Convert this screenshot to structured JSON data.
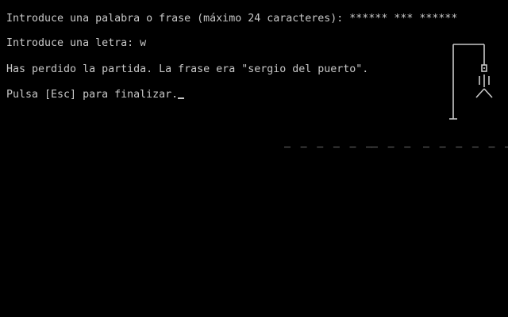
{
  "console": {
    "prompt_phrase": "Introduce una palabra o frase (máximo 24 caracteres): ",
    "masked_phrase": "****** *** ******",
    "prompt_letter": "Introduce una letra: ",
    "letter_value": "w",
    "result_message": "Has perdido la partida. La frase era \"sergio del puerto\".",
    "exit_prompt": "Pulsa [Esc] para finalizar."
  },
  "word_slots": [
    {
      "dashes": "_ _ _ _ _ _"
    },
    {
      "dashes": "_ _ _"
    },
    {
      "dashes": "_ _ _ _ _ _"
    }
  ],
  "hangman": {
    "icon": "hangman-gallows-icon",
    "state": "complete"
  },
  "colors": {
    "background": "#000000",
    "text": "#c8c8c8"
  }
}
